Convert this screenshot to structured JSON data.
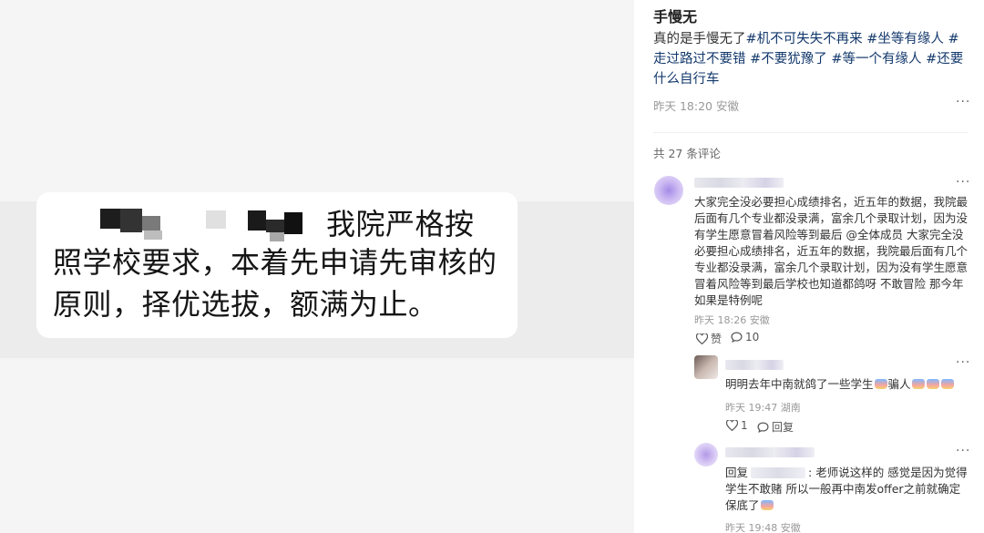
{
  "image": {
    "line1": "我院严格按",
    "line2": "照学校要求，本着先申请先审核的",
    "line3": "原则，择优选拔，额满为止。"
  },
  "post": {
    "author": "手慢无",
    "text_prefix": "真的是手慢无了",
    "tags": [
      "#机不可失失不再来",
      "#坐等有缘人",
      "#走过路过不要错",
      "#不要犹豫了",
      "#等一个有缘人",
      "#还要什么自行车"
    ],
    "date": "昨天 18:20",
    "location": "安徽",
    "more": "···"
  },
  "comments_header": "共 27 条评论",
  "comments": [
    {
      "text": "大家完全没必要担心成绩排名，近五年的数据，我院最后面有几个专业都没录满，富余几个录取计划，因为没有学生愿意冒着风险等到最后 @全体成员 大家完全没必要担心成绩排名，近五年的数据，我院最后面有几个专业都没录满，富余几个录取计划，因为没有学生愿意冒着风险等到最后学校也知道都鸽呀 不敢冒险 那今年如果是特例呢",
      "date": "昨天 18:26",
      "location": "安徽",
      "like_label": "赞",
      "reply_count": "10",
      "more": "···"
    }
  ],
  "replies": [
    {
      "text_a": "明明去年中南就鸽了一些学生",
      "text_b": "骗人",
      "date": "昨天 19:47",
      "location": "湖南",
      "likes": "1",
      "reply_label": "回复",
      "more": "···"
    },
    {
      "reply_prefix": "回复",
      "text_a": ": 老师说这样的 感觉是因为觉得学生不敢赌 所以一般再中南发offer之前就确定保底了",
      "date": "昨天 19:48",
      "location": "安徽",
      "more": "···"
    }
  ],
  "colors": {
    "tag": "#13386c",
    "meta": "#999999",
    "viewer_bg": "#f5f5f5"
  },
  "icons": [
    "heart-icon",
    "comment-icon",
    "more-icon"
  ]
}
